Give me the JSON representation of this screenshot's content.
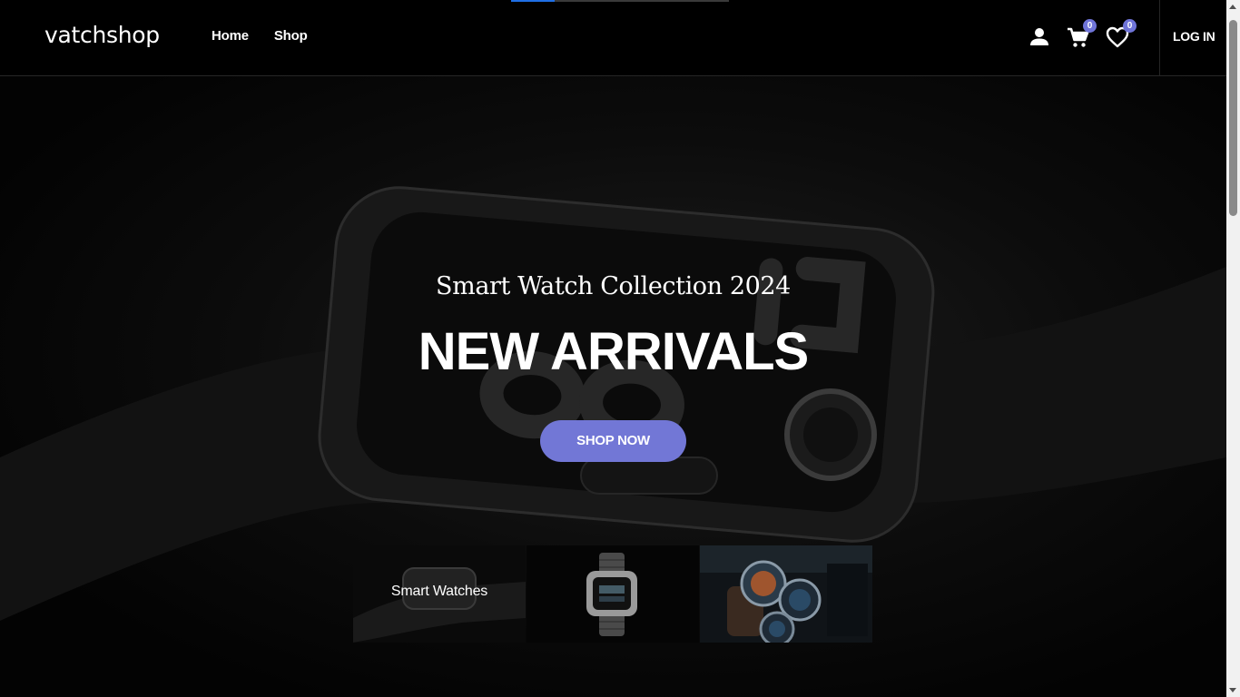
{
  "loading_bar": {
    "progress": 0.2
  },
  "header": {
    "logo": "vatchshop",
    "nav": [
      {
        "label": "Home"
      },
      {
        "label": "Shop"
      }
    ],
    "account_icon": "user-icon",
    "cart": {
      "icon": "cart-icon",
      "count": "0"
    },
    "wishlist": {
      "icon": "heart-icon",
      "count": "0"
    },
    "login_label": "LOG IN"
  },
  "hero": {
    "subtitle": "Smart Watch Collection 2024",
    "title": "NEW ARRIVALS",
    "cta_label": "SHOP NOW"
  },
  "categories": [
    {
      "label": "Smart Watches"
    },
    {
      "label": ""
    },
    {
      "label": ""
    }
  ],
  "colors": {
    "accent": "#7277d6",
    "badge": "#6f74d8",
    "progress": "#1f6fe5",
    "background": "#000000"
  }
}
